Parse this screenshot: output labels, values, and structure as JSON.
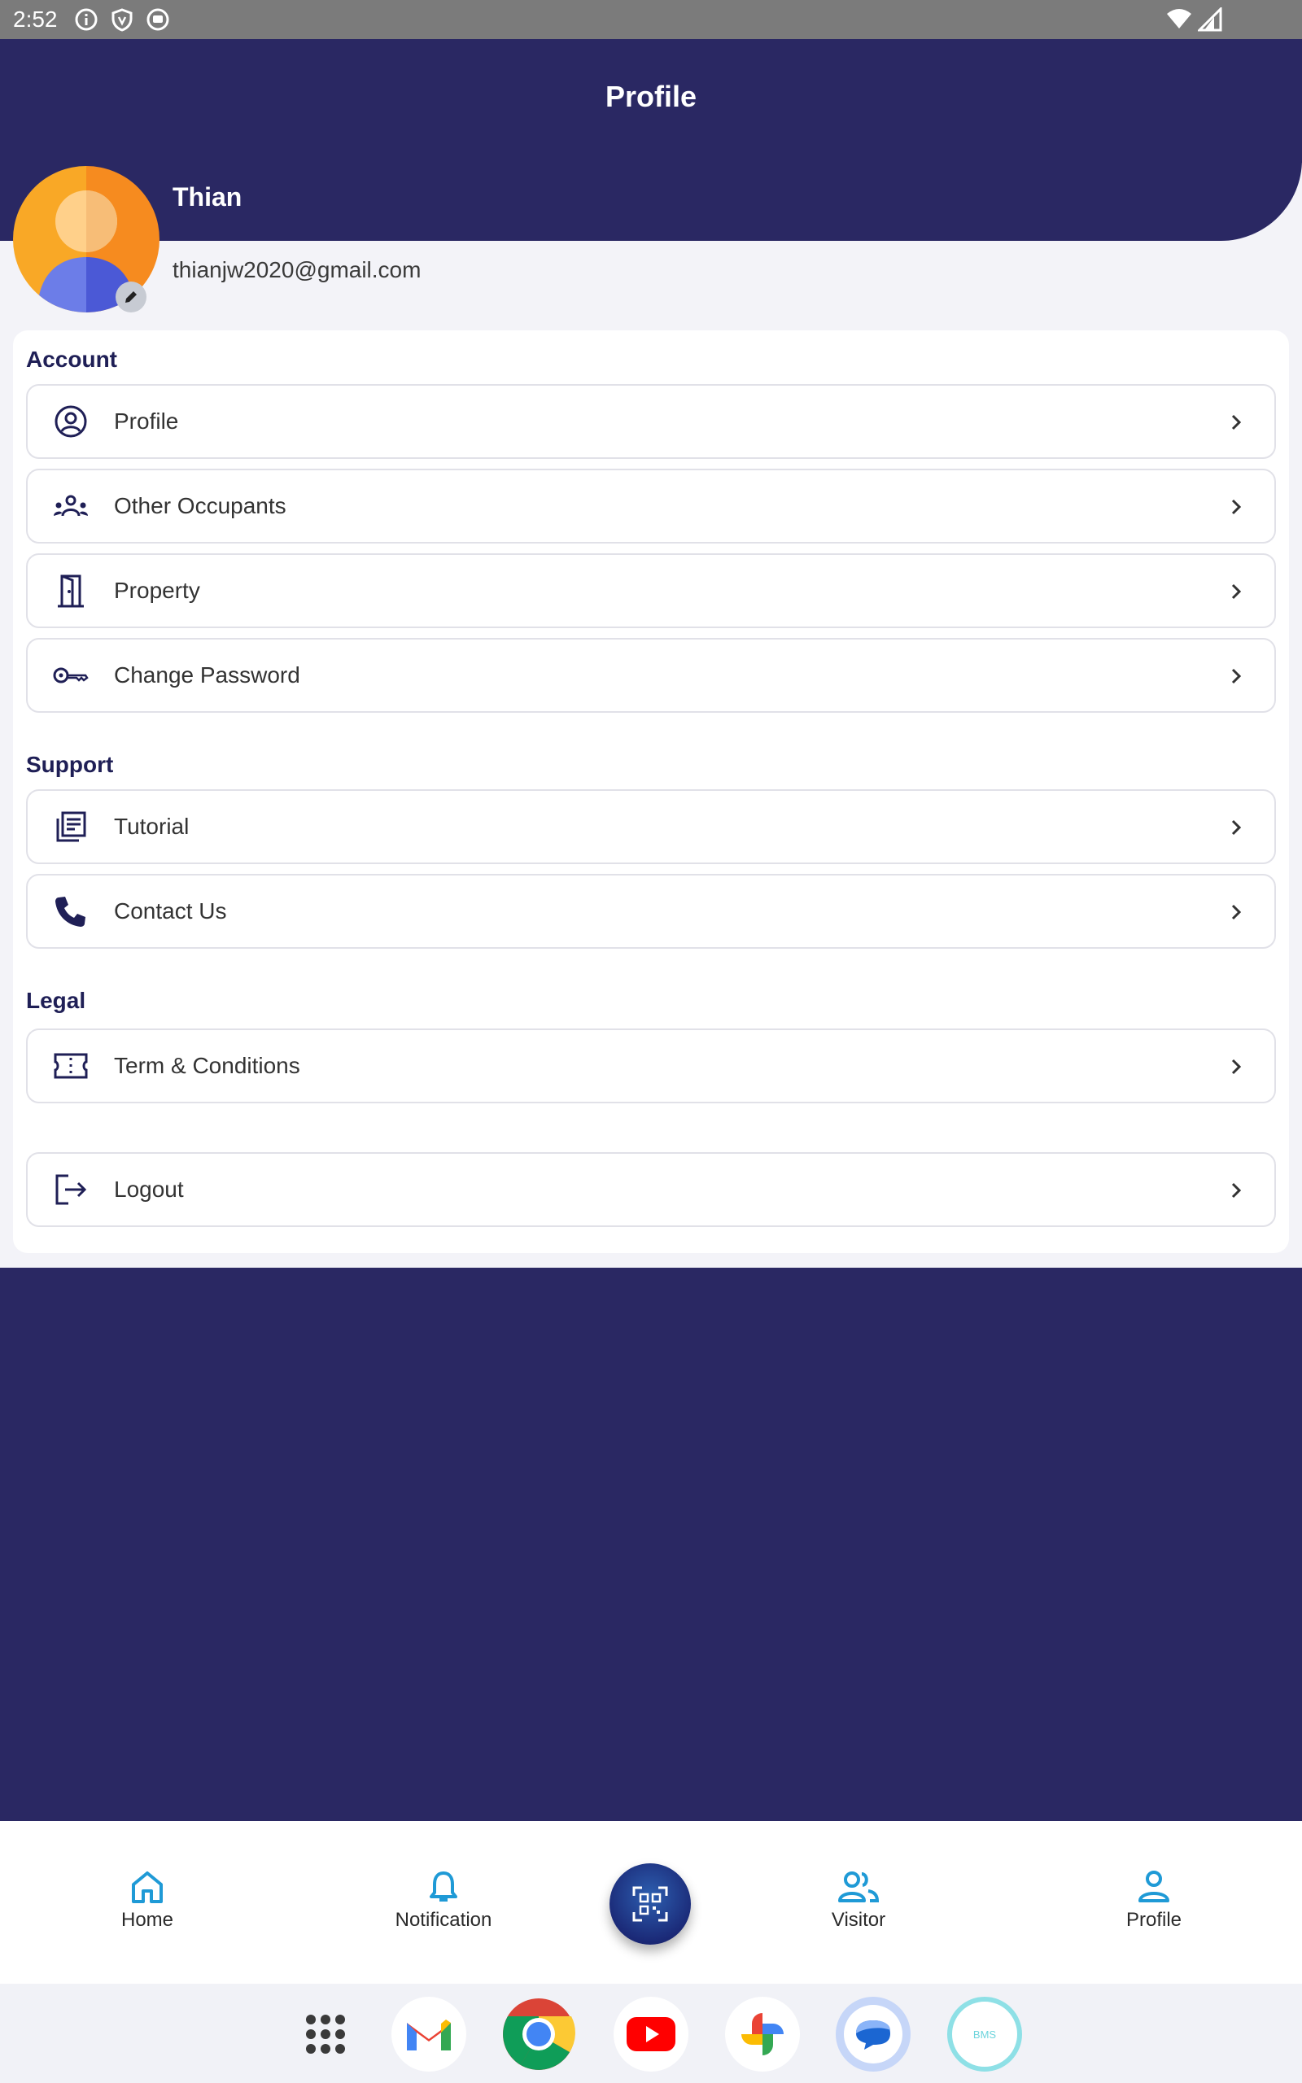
{
  "status_bar": {
    "time": "2:52",
    "icons": [
      "info-icon",
      "shield-icon",
      "sync-icon"
    ],
    "right_icons": [
      "wifi-icon",
      "signal-icon"
    ]
  },
  "header": {
    "title": "Profile"
  },
  "user": {
    "name": "Thian",
    "email": "thianjw2020@gmail.com"
  },
  "sections": {
    "account": {
      "title": "Account",
      "items": [
        {
          "label": "Profile",
          "icon": "user-circle-icon"
        },
        {
          "label": "Other Occupants",
          "icon": "group-icon"
        },
        {
          "label": "Property",
          "icon": "door-icon"
        },
        {
          "label": "Change Password",
          "icon": "key-icon"
        }
      ]
    },
    "support": {
      "title": "Support",
      "items": [
        {
          "label": "Tutorial",
          "icon": "document-icon"
        },
        {
          "label": "Contact Us",
          "icon": "phone-icon"
        }
      ]
    },
    "legal": {
      "title": "Legal",
      "items": [
        {
          "label": "Term & Conditions",
          "icon": "ticket-icon"
        }
      ]
    },
    "logout": {
      "label": "Logout",
      "icon": "logout-icon"
    }
  },
  "bottom_nav": {
    "items": [
      {
        "label": "Home",
        "icon": "home-icon"
      },
      {
        "label": "Notification",
        "icon": "bell-icon"
      },
      {
        "label": "Visitor",
        "icon": "visitor-icon"
      },
      {
        "label": "Profile",
        "icon": "person-icon"
      }
    ],
    "center_button_icon": "qr-scan-icon"
  },
  "dock": {
    "apps": [
      "app-drawer-icon",
      "gmail-icon",
      "chrome-icon",
      "youtube-icon",
      "photos-icon",
      "messages-icon",
      "bms-app-icon"
    ],
    "bms_label": "BMS"
  },
  "colors": {
    "primary": "#2a2863",
    "accent": "#1f9ad6",
    "background": "#f3f3f8"
  }
}
